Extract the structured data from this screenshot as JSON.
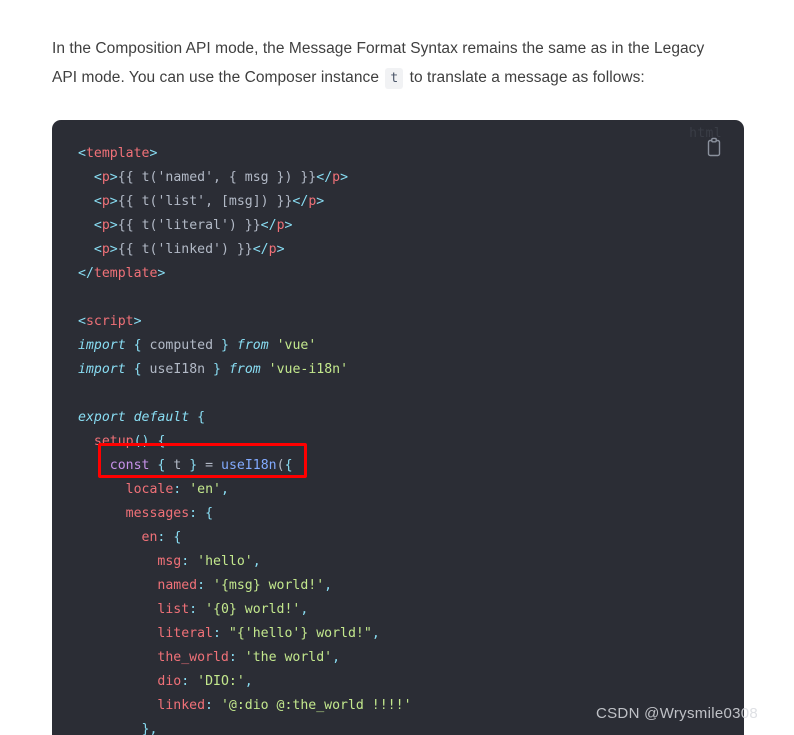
{
  "prose": {
    "part1": "In the Composition API mode, the Message Format Syntax remains the same as in the Legacy API mode. You can use the Composer instance ",
    "inline_code": "t",
    "part2": " to translate a message as follows:"
  },
  "code_block": {
    "language_label": "html",
    "copy_icon": "clipboard-icon",
    "lines": [
      "<template>",
      "  <p>{{ t('named', { msg }) }}</p>",
      "  <p>{{ t('list', [msg]) }}</p>",
      "  <p>{{ t('literal') }}</p>",
      "  <p>{{ t('linked') }}</p>",
      "</template>",
      "",
      "<script>",
      "import { computed } from 'vue'",
      "import { useI18n } from 'vue-i18n'",
      "",
      "export default {",
      "  setup() {",
      "    const { t } = useI18n({",
      "      locale: 'en',",
      "      messages: {",
      "        en: {",
      "          msg: 'hello',",
      "          named: '{msg} world!',",
      "          list: '{0} world!',",
      "          literal: \"{'hello'} world!\",",
      "          the_world: 'the world',",
      "          dio: 'DIO:',",
      "          linked: '@:dio @:the_world !!!!'",
      "        },"
    ]
  },
  "annotation": {
    "label": "highlight-const-t-useI18n",
    "color": "#ff0000"
  },
  "watermark": {
    "text": "CSDN @Wrysmile0308"
  },
  "colors": {
    "code_background": "#2b2d35",
    "page_background": "#ffffff",
    "prose_text": "#3f3f3f",
    "inline_code_background": "#f1f2f4",
    "annotation_red": "#ff0000"
  }
}
